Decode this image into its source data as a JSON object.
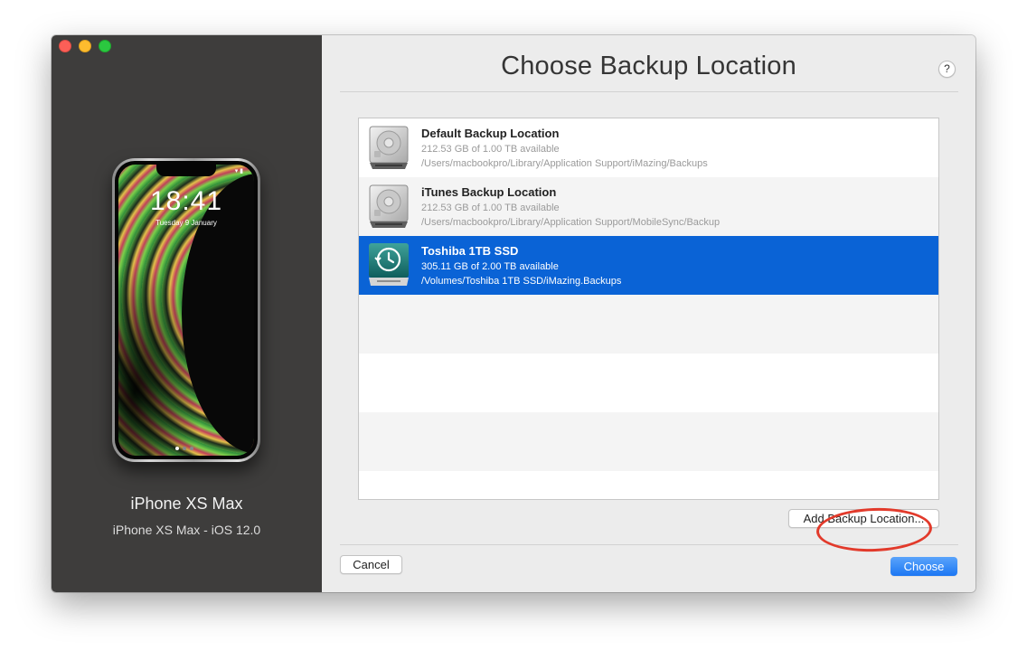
{
  "window": {
    "traffic_lights": [
      "close",
      "minimize",
      "zoom"
    ]
  },
  "device": {
    "lock_time": "18:41",
    "lock_date": "Tuesday 9 January",
    "name": "iPhone XS Max",
    "subtitle": "iPhone XS Max - iOS 12.0"
  },
  "dialog": {
    "title": "Choose Backup Location",
    "help_label": "?"
  },
  "locations": [
    {
      "name": "Default Backup Location",
      "available": "212.53 GB of 1.00 TB available",
      "path": "/Users/macbookpro/Library/Application Support/iMazing/Backups",
      "icon": "hard-drive-icon",
      "selected": false
    },
    {
      "name": "iTunes Backup Location",
      "available": "212.53 GB of 1.00 TB available",
      "path": "/Users/macbookpro/Library/Application Support/MobileSync/Backup",
      "icon": "hard-drive-icon",
      "selected": false
    },
    {
      "name": "Toshiba 1TB SSD",
      "available": "305.11 GB of 2.00 TB available",
      "path": "/Volumes/Toshiba 1TB SSD/iMazing.Backups",
      "icon": "time-machine-drive-icon",
      "selected": true
    }
  ],
  "buttons": {
    "add_location": "Add Backup Location...",
    "cancel": "Cancel",
    "choose": "Choose"
  },
  "colors": {
    "selection": "#0a63d6",
    "primary_button": "#1c77f3",
    "highlight": "#e23a2b",
    "sidebar": "#3e3d3c"
  }
}
